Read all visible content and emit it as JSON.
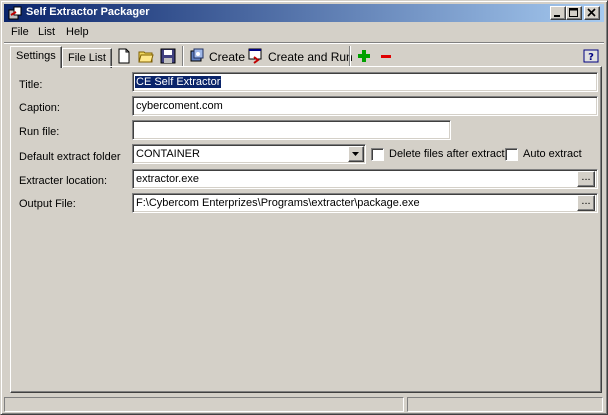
{
  "window": {
    "title": "Self Extractor Packager"
  },
  "menu": {
    "file": "File",
    "list": "List",
    "help": "Help"
  },
  "tabs": [
    {
      "label": "Settings"
    },
    {
      "label": "File List"
    }
  ],
  "toolbar": {
    "create_label": "Create",
    "create_run_label": "Create and Run"
  },
  "form": {
    "title_label": "Title:",
    "title_value": "CE Self Extractor",
    "caption_label": "Caption:",
    "caption_value": "cybercoment.com",
    "run_file_label": "Run file:",
    "run_file_value": "",
    "extract_folder_label": "Default extract folder",
    "extract_folder_value": "CONTAINER",
    "delete_files_label": "Delete files after extract",
    "delete_files_checked": false,
    "auto_extract_label": "Auto extract",
    "auto_extract_checked": false,
    "extracter_location_label": "Extracter location:",
    "extracter_location_value": "extractor.exe",
    "output_file_label": "Output File:",
    "output_file_value": "F:\\Cybercom Enterprizes\\Programs\\extracter\\package.exe",
    "browse_label": "..."
  },
  "status": {
    "pane1": "",
    "pane2": ""
  },
  "colors": {
    "titlebar_start": "#0a246a",
    "titlebar_end": "#a6caf0",
    "face": "#d4d0c8",
    "selection": "#0a246a"
  }
}
